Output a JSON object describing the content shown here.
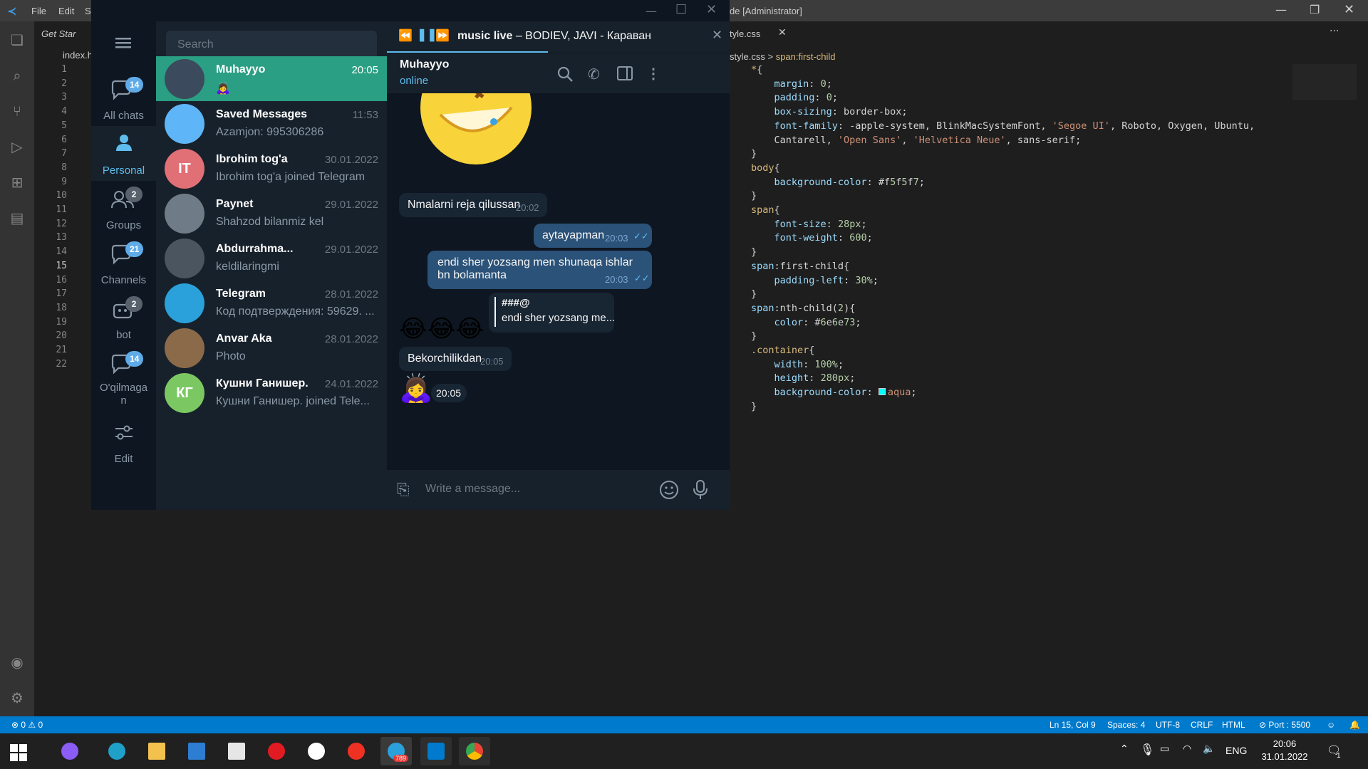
{
  "vscode": {
    "menu": [
      "File",
      "Edit",
      "S"
    ],
    "title_suffix": "de [Administrator]",
    "left_tab": "Get Star",
    "left_file": "index.h",
    "right_tab": "tyle.css",
    "breadcrumb_file": "style.css",
    "breadcrumb_sep": ">",
    "breadcrumb_symbol": "span:first-child",
    "line_numbers": [
      "1",
      "2",
      "3",
      "4",
      "5",
      "6",
      "7",
      "8",
      "9",
      "10",
      "11",
      "12",
      "13",
      "14",
      "15",
      "16",
      "17",
      "18",
      "19",
      "20",
      "21",
      "22"
    ],
    "current_line": "15",
    "code_lines": [
      "*{",
      "    margin: 0;",
      "    padding: 0;",
      "    box-sizing: border-box;",
      "    font-family: -apple-system, BlinkMacSystemFont, 'Segoe UI', Roboto, Oxygen, Ubuntu,",
      "    Cantarell, 'Open Sans', 'Helvetica Neue', sans-serif;",
      "}",
      "body{",
      "    background-color: #f5f5f7;",
      "}",
      "span{",
      "    font-size: 28px;",
      "    font-weight: 600;",
      "}",
      "span:first-child{",
      "    padding-left: 30%;",
      "}",
      "span:nth-child(2){",
      "    color: #6e6e73;",
      "}",
      ".container{",
      "    width: 100%;",
      "    height: 280px;",
      "    background-color: aqua;",
      "}"
    ],
    "swatches": {
      "bg": "#f5f5f7",
      "color": "#6e6e73",
      "aqua": "#00ffff"
    },
    "status": {
      "problems": "⊗ 0 ⚠ 0",
      "position": "Ln 15, Col 9",
      "spaces": "Spaces: 4",
      "encoding": "UTF-8",
      "eol": "CRLF",
      "language": "HTML",
      "port": "⊘ Port : 5500"
    },
    "accent": "#007acc"
  },
  "telegram": {
    "search_placeholder": "Search",
    "folders": [
      {
        "label": "All chats",
        "badge": "14"
      },
      {
        "label": "Personal",
        "badge": ""
      },
      {
        "label": "Groups",
        "badge": "2"
      },
      {
        "label": "Channels",
        "badge": "21"
      },
      {
        "label": "bot",
        "badge": "2"
      },
      {
        "label": "O'qilmaga n",
        "badge": "14"
      },
      {
        "label": "Edit",
        "badge": ""
      }
    ],
    "chats": [
      {
        "name": "Muhayyo",
        "date": "20:05",
        "preview": "🙇‍♀️",
        "avatar_text": "",
        "avatar_color": "#3b4a5c"
      },
      {
        "name": "Saved Messages",
        "date": "11:53",
        "preview": "Azamjon: 995306286",
        "avatar_text": "",
        "avatar_color": "#5eb5f7"
      },
      {
        "name": "Ibrohim tog'a",
        "date": "30.01.2022",
        "preview": "Ibrohim tog'a joined Telegram",
        "avatar_text": "IT",
        "avatar_color": "#e17076"
      },
      {
        "name": "Paynet",
        "date": "29.01.2022",
        "preview": "Shahzod bilanmiz kel",
        "avatar_text": "",
        "avatar_color": "#6f7b86"
      },
      {
        "name": "Abdurrahma...",
        "date": "29.01.2022",
        "preview": "keldilaringmi",
        "avatar_text": "",
        "avatar_color": "#4a5560"
      },
      {
        "name": "Telegram",
        "date": "28.01.2022",
        "preview": "Код подтверждения: 59629. ...",
        "avatar_text": "",
        "avatar_color": "#2aa1da"
      },
      {
        "name": "Anvar Aka",
        "date": "28.01.2022",
        "preview": "Photo",
        "avatar_text": "",
        "avatar_color": "#8b6a4a"
      },
      {
        "name": "Кушни Ганишер.",
        "date": "24.01.2022",
        "preview": "Кушни Ганишер. joined Tele...",
        "avatar_text": "КГ",
        "avatar_color": "#7bc862"
      }
    ],
    "player": {
      "title": "music live",
      "track": " – BODIEV, JAVI - Караван"
    },
    "header": {
      "name": "Muhayyo",
      "status": "online"
    },
    "messages": [
      {
        "text": "Nmalarni reja qilussan",
        "time": "20:02",
        "out": false
      },
      {
        "text": "aytayapman",
        "time": "20:03",
        "out": true
      },
      {
        "text": "endi sher yozsang men shunaqa ishlar bn bolamanta",
        "time": "20:03",
        "out": true
      },
      {
        "reply_name": "###@",
        "reply_text": "endi sher yozsang me...",
        "out": false
      },
      {
        "emoji": "😂😂😂",
        "out": false
      },
      {
        "text": "Bekorchilikdan",
        "time": "20:05",
        "out": false
      },
      {
        "emoji": "🙇‍♀️",
        "time": "20:05",
        "out": false
      }
    ],
    "input_placeholder": "Write a message...",
    "accent": "#2b9f83"
  },
  "taskbar": {
    "lang": "ENG",
    "time": "20:06",
    "date": "31.01.2022",
    "telegram_badge": "789",
    "notif_count": "1"
  }
}
